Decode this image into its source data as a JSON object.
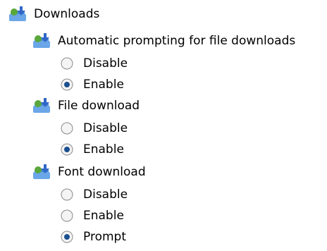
{
  "tree": {
    "root": {
      "label": "Downloads",
      "icon": "downloads-policy-folder-icon"
    },
    "groups": [
      {
        "label": "Automatic prompting for file downloads",
        "icon": "downloads-policy-folder-icon",
        "options": [
          {
            "label": "Disable",
            "selected": false
          },
          {
            "label": "Enable",
            "selected": true
          }
        ]
      },
      {
        "label": "File download",
        "icon": "downloads-policy-folder-icon",
        "options": [
          {
            "label": "Disable",
            "selected": false
          },
          {
            "label": "Enable",
            "selected": true
          }
        ]
      },
      {
        "label": "Font download",
        "icon": "downloads-policy-folder-icon",
        "options": [
          {
            "label": "Disable",
            "selected": false
          },
          {
            "label": "Enable",
            "selected": false
          },
          {
            "label": "Prompt",
            "selected": true
          }
        ]
      }
    ]
  },
  "colors": {
    "text": "#000000",
    "radio_border": "#8a8a8a",
    "radio_fill": "#f4f4f4",
    "radio_dot": "#1b4f8f",
    "folder_blue": "#4e8fd8",
    "folder_green": "#5aa83c",
    "arrow_blue": "#2f67c8"
  }
}
